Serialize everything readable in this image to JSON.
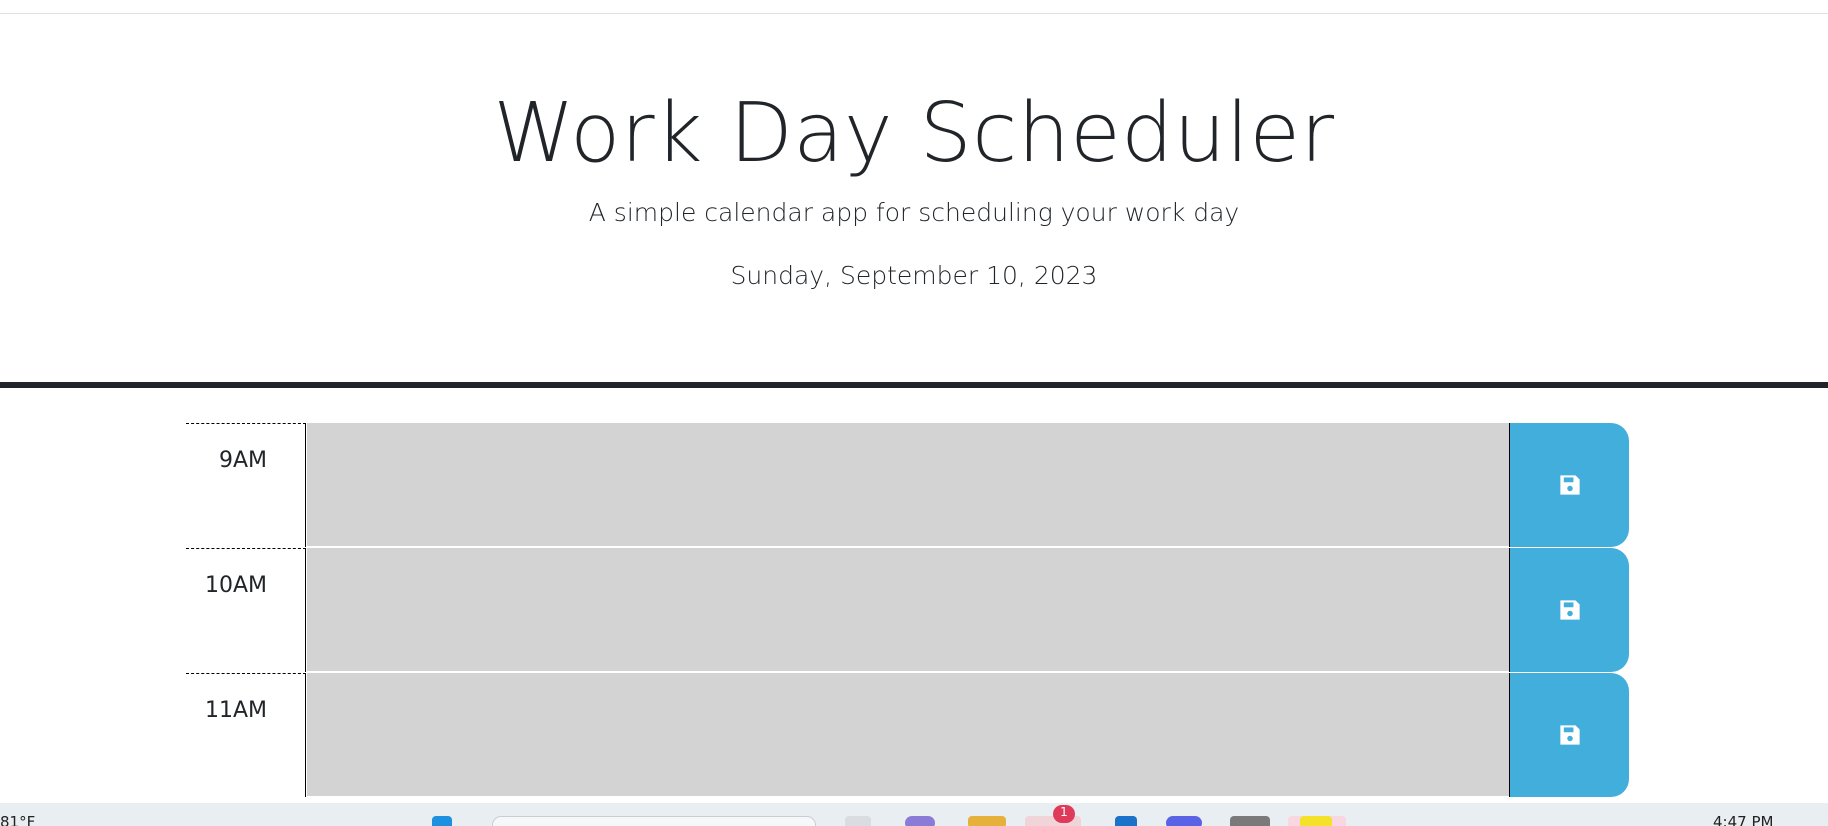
{
  "header": {
    "title": "Work Day Scheduler",
    "lead": "A simple calendar app for scheduling your work day",
    "current_date": "Sunday, September 10, 2023"
  },
  "time_blocks": [
    {
      "hour": "9AM",
      "task": "",
      "state": "past"
    },
    {
      "hour": "10AM",
      "task": "",
      "state": "past"
    },
    {
      "hour": "11AM",
      "task": "",
      "state": "past"
    }
  ],
  "save_icon": "floppy-disk-icon",
  "colors": {
    "past": "#d3d3d3",
    "save_button": "#42aedb",
    "header_border": "#212529"
  },
  "taskbar": {
    "weather": "81°F",
    "clock": "4:47 PM",
    "notification_badge": "1"
  }
}
